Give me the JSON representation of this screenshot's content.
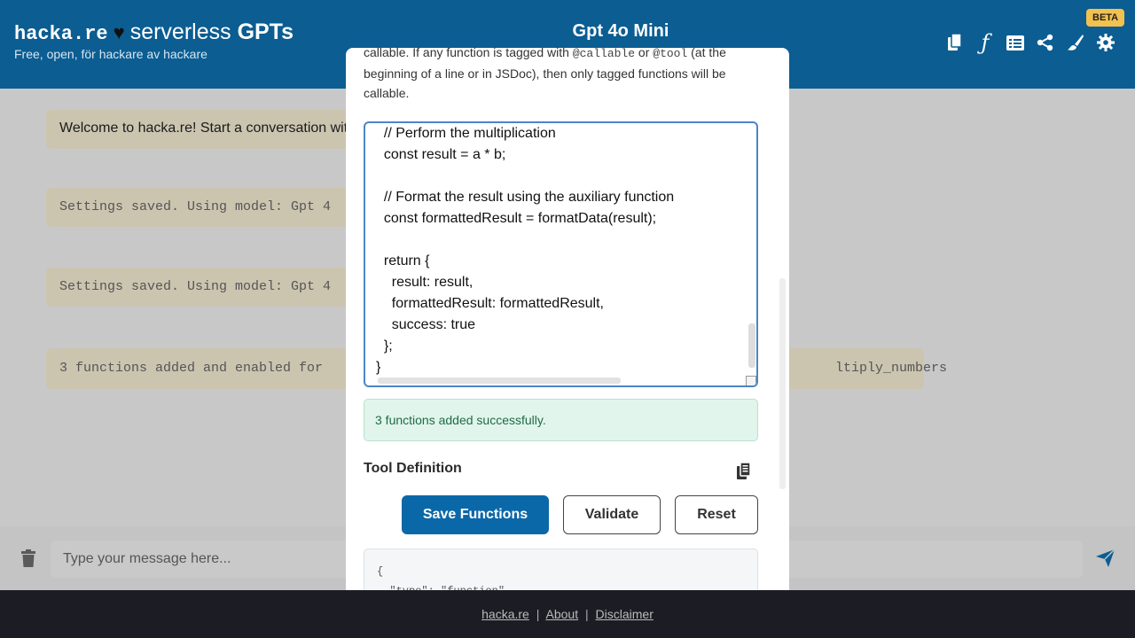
{
  "header": {
    "brand_code": "hacka.re",
    "brand_heart": "♥",
    "brand_prefix": "serverless",
    "brand_suffix": "GPTs",
    "tagline": "Free, open, för hackare av hackare",
    "model_title": "Gpt 4o Mini",
    "beta": "BETA",
    "icons": [
      "copy-icon",
      "function-icon",
      "prompts-icon",
      "share-icon",
      "theme-icon",
      "settings-icon"
    ],
    "function_glyph": "ƒ"
  },
  "chat": {
    "messages": [
      "Welcome to hacka.re! Start a conversation wit",
      "Settings saved. Using model: Gpt 4",
      "Settings saved. Using model: Gpt 4",
      "3 functions added and enabled for"
    ],
    "message4_tail": "ltiply_numbers"
  },
  "input": {
    "placeholder": "Type your message here..."
  },
  "footer": {
    "links": [
      "hacka.re",
      "About",
      "Disclaimer"
    ],
    "separator": "|"
  },
  "modal": {
    "desc_part1": "callable. If any function is tagged with ",
    "tag1": "@callable",
    "desc_or": " or ",
    "tag2": "@tool",
    "desc_part2": " (at the beginning of a line or in JSDoc), then only tagged functions will be callable.",
    "code_lines": [
      "  // Perform the multiplication",
      "  const result = a * b;",
      "",
      "  // Format the result using the auxiliary function",
      "  const formattedResult = formatData(result);",
      "",
      "  return {",
      "    result: result,",
      "    formattedResult: formattedResult,",
      "    success: true",
      "  };",
      "}"
    ],
    "success_message": "3 functions added successfully.",
    "tool_definition_label": "Tool Definition",
    "buttons": {
      "save": "Save Functions",
      "validate": "Validate",
      "reset": "Reset"
    },
    "json_preview": "{\n  \"type\": \"function\","
  },
  "colors": {
    "header_bg": "#0b5d92",
    "primary_button": "#0b68a8",
    "beta_badge": "#f2c14e",
    "success_bg": "#e1f5ec",
    "footer_bg": "#1c1d24"
  }
}
